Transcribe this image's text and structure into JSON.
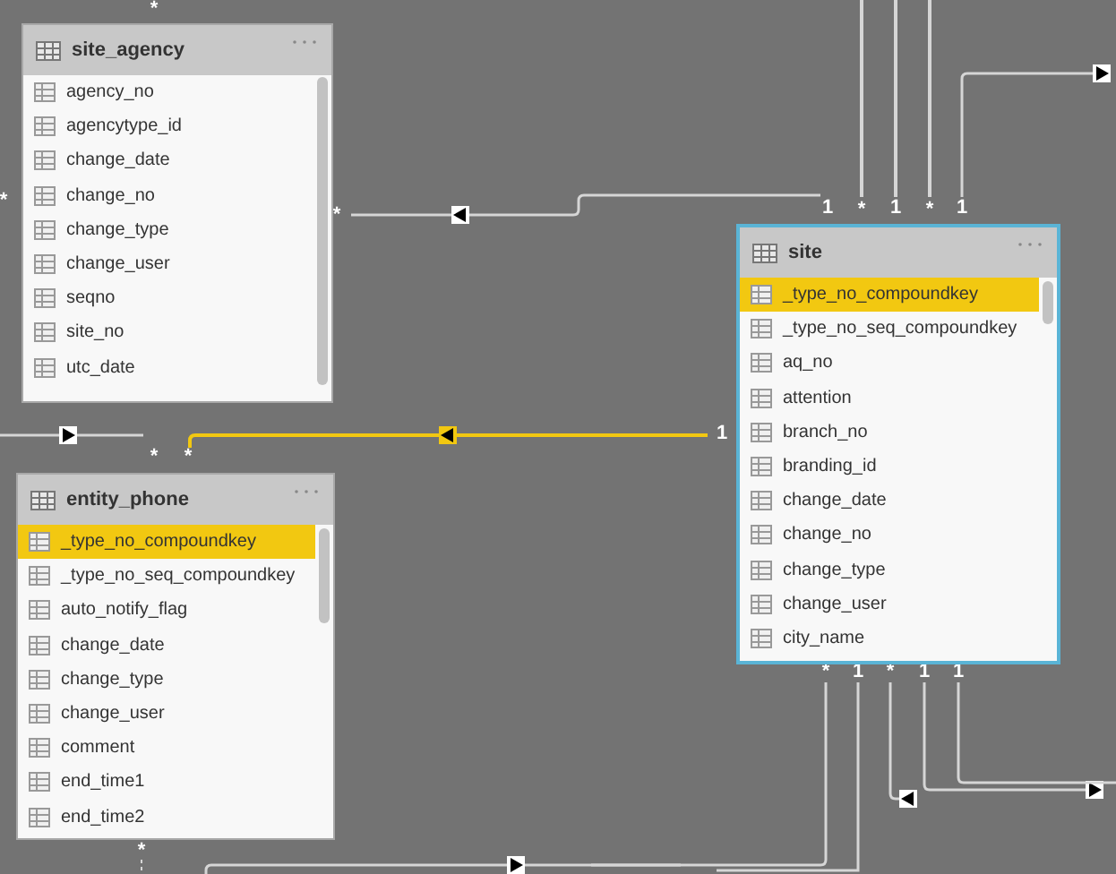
{
  "tables": [
    {
      "name": "site_agency",
      "columns": [
        {
          "name": "agency_no",
          "selected": false
        },
        {
          "name": "agencytype_id",
          "selected": false
        },
        {
          "name": "change_date",
          "selected": false
        },
        {
          "name": "change_no",
          "selected": false
        },
        {
          "name": "change_type",
          "selected": false
        },
        {
          "name": "change_user",
          "selected": false
        },
        {
          "name": "seqno",
          "selected": false
        },
        {
          "name": "site_no",
          "selected": false
        },
        {
          "name": "utc_date",
          "selected": false
        }
      ]
    },
    {
      "name": "entity_phone",
      "columns": [
        {
          "name": "_type_no_compoundkey",
          "selected": true
        },
        {
          "name": "_type_no_seq_compoundkey",
          "selected": false
        },
        {
          "name": "auto_notify_flag",
          "selected": false
        },
        {
          "name": "change_date",
          "selected": false
        },
        {
          "name": "change_type",
          "selected": false
        },
        {
          "name": "change_user",
          "selected": false
        },
        {
          "name": "comment",
          "selected": false
        },
        {
          "name": "end_time1",
          "selected": false
        },
        {
          "name": "end_time2",
          "selected": false
        }
      ]
    },
    {
      "name": "site",
      "columns": [
        {
          "name": "_type_no_compoundkey",
          "selected": true
        },
        {
          "name": "_type_no_seq_compoundkey",
          "selected": false
        },
        {
          "name": "aq_no",
          "selected": false
        },
        {
          "name": "attention",
          "selected": false
        },
        {
          "name": "branch_no",
          "selected": false
        },
        {
          "name": "branding_id",
          "selected": false
        },
        {
          "name": "change_date",
          "selected": false
        },
        {
          "name": "change_no",
          "selected": false
        },
        {
          "name": "change_type",
          "selected": false
        },
        {
          "name": "change_user",
          "selected": false
        },
        {
          "name": "city_name",
          "selected": false
        }
      ]
    }
  ],
  "cardinality_labels": [
    "*",
    "*",
    "*",
    "1",
    "*",
    "1",
    "*",
    "1",
    "1",
    "*",
    "*",
    "*",
    "1",
    "*",
    "1",
    "1",
    "*"
  ],
  "relationships": [
    {
      "selected": false
    },
    {
      "selected": false
    },
    {
      "selected": false
    },
    {
      "selected": false
    },
    {
      "selected": false
    },
    {
      "selected": false
    },
    {
      "selected": true
    },
    {
      "selected": false
    },
    {
      "selected": false
    },
    {
      "selected": false
    },
    {
      "selected": false
    },
    {
      "selected": false
    },
    {
      "selected": false
    }
  ]
}
